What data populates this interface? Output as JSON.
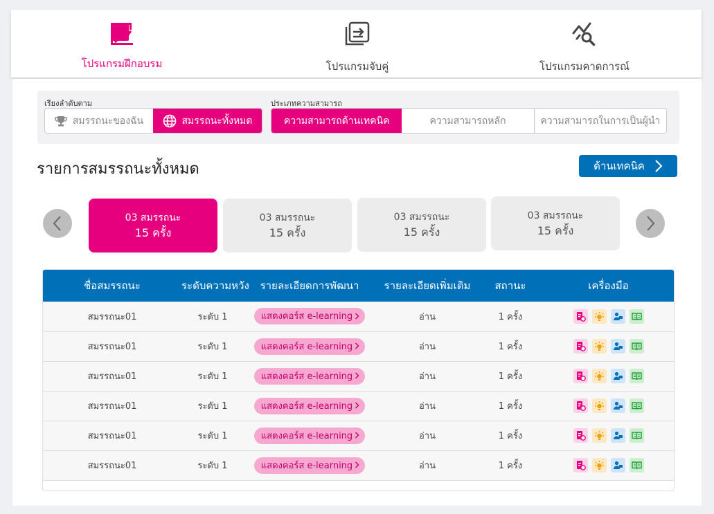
{
  "nav": {
    "items": [
      {
        "label": "โปรแกรมฝึกอบรม",
        "icon": "training-chart-icon",
        "active": true
      },
      {
        "label": "โปรแกรมจับคู่",
        "icon": "matching-icon",
        "active": false
      },
      {
        "label": "โปรแกรมคาดการณ์",
        "icon": "forecast-search-icon",
        "active": false
      }
    ]
  },
  "filters": {
    "sort_label": "เรียงลำดับตาม",
    "sort_options": [
      {
        "label": "สมรรถนะของฉัน",
        "icon": "trophy-icon",
        "active": false
      },
      {
        "label": "สมรรถนะทั้งหมด",
        "icon": "globe-icon",
        "active": true
      }
    ],
    "type_label": "ประเภทความสามารถ",
    "type_options": [
      {
        "label": "ความสามารถด้านเทคนิค",
        "active": true
      },
      {
        "label": "ความสามารถหลัก",
        "active": false
      },
      {
        "label": "ความสามารถในการเป็นผู้นำ",
        "active": false
      }
    ]
  },
  "section": {
    "title": "รายการสมรรถนะทั้งหมด",
    "tech_button": "ด้านเทคนิค"
  },
  "cards": [
    {
      "line1": "03 สมรรถนะ",
      "line2": "15 ครั้ง",
      "active": true
    },
    {
      "line1": "03 สมรรถนะ",
      "line2": "15 ครั้ง",
      "active": false
    },
    {
      "line1": "03 สมรรถนะ",
      "line2": "15 ครั้ง",
      "active": false
    },
    {
      "line1": "03 สมรรถนะ",
      "line2": "15 ครั้ง",
      "active": false
    }
  ],
  "table": {
    "headers": [
      "ชื่อสมรรถนะ",
      "ระดับความหวัง",
      "รายละเอียดการพัฒนา",
      "รายละเอียดเพิ่มเติม",
      "สถานะ",
      "เครื่องมือ"
    ],
    "rows": [
      {
        "name": "สมรรถนะ01",
        "level": "ระดับ 1",
        "dev": "แสดงคอร์ส e-learning",
        "more": "อ่าน",
        "status": "1 ครั้ง"
      },
      {
        "name": "สมรรถนะ01",
        "level": "ระดับ 1",
        "dev": "แสดงคอร์ส e-learning",
        "more": "อ่าน",
        "status": "1 ครั้ง"
      },
      {
        "name": "สมรรถนะ01",
        "level": "ระดับ 1",
        "dev": "แสดงคอร์ส e-learning",
        "more": "อ่าน",
        "status": "1 ครั้ง"
      },
      {
        "name": "สมรรถนะ01",
        "level": "ระดับ 1",
        "dev": "แสดงคอร์ส e-learning",
        "more": "อ่าน",
        "status": "1 ครั้ง"
      },
      {
        "name": "สมรรถนะ01",
        "level": "ระดับ 1",
        "dev": "แสดงคอร์ส e-learning",
        "more": "อ่าน",
        "status": "1 ครั้ง"
      },
      {
        "name": "สมรรถนะ01",
        "level": "ระดับ 1",
        "dev": "แสดงคอร์ส e-learning",
        "more": "อ่าน",
        "status": "1 ครั้ง"
      }
    ],
    "tools": [
      "document-settings-icon",
      "idea-bulb-icon",
      "user-chat-icon",
      "open-book-icon"
    ]
  },
  "colors": {
    "primary_pink": "#e6007e",
    "primary_blue": "#0070b8"
  }
}
